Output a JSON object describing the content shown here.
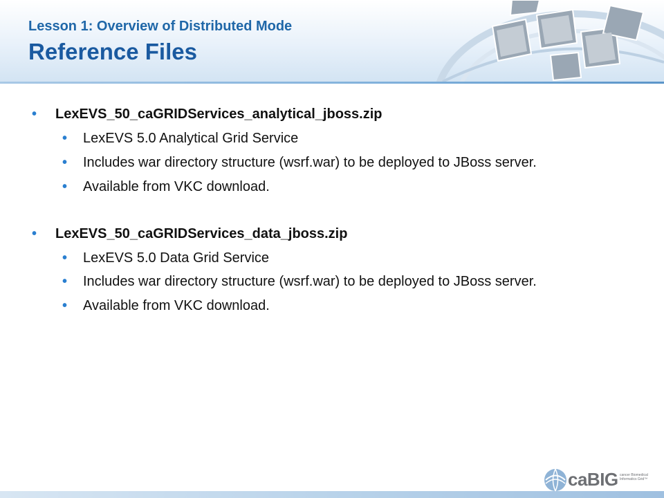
{
  "header": {
    "subtitle": "Lesson 1: Overview of Distributed Mode",
    "title": "Reference Files"
  },
  "bullet_char": "•",
  "sections": [
    {
      "heading": "LexEVS_50_caGRIDServices_analytical_jboss.zip",
      "items": [
        "LexEVS 5.0 Analytical Grid Service",
        "Includes war directory structure (wsrf.war) to be deployed to JBoss server.",
        "Available from VKC download."
      ]
    },
    {
      "heading": "LexEVS_50_caGRIDServices_data_jboss.zip",
      "items": [
        "LexEVS 5.0 Data Grid Service",
        "Includes war directory structure (wsrf.war) to be deployed to JBoss server.",
        "Available from VKC download."
      ]
    }
  ],
  "logo": {
    "text": "caBIG",
    "tagline": "cancer Biomedical Informatics Grid™"
  },
  "colors": {
    "title": "#1a5aa0",
    "bullet": "#2a7fd0",
    "text": "#111111"
  }
}
